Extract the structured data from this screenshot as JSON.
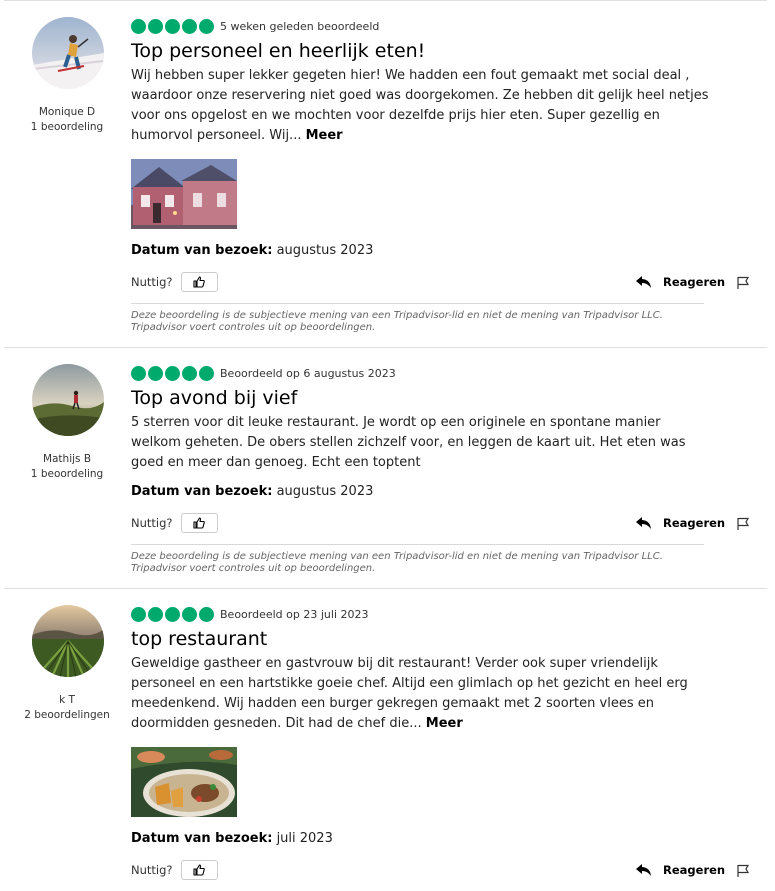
{
  "reviews": [
    {
      "author": "Monique D",
      "contributions": "1 beoordeling",
      "rating": 5,
      "date_text": "5 weken geleden beoordeeld",
      "title": "Top personeel en heerlijk eten!",
      "body": "Wij hebben super lekker gegeten hier! We hadden een fout gemaakt met social deal , waardoor onze reservering niet goed was doorgekomen. Ze hebben dit gelijk heel netjes voor ons opgelost en we mochten voor dezelfde prijs hier eten. Super gezellig en humorvol personeel. Wij...",
      "more_label": "Meer",
      "visit_label": "Datum van bezoek:",
      "visit_value": "augustus 2023",
      "helpful_label": "Nuttig?",
      "reply_label": "Reageren",
      "disclaimer": "Deze beoordeling is de subjectieve mening van een Tripadvisor-lid en niet de mening van Tripadvisor LLC. Tripadvisor voert controles uit op beoordelingen."
    },
    {
      "author": "Mathijs B",
      "contributions": "1 beoordeling",
      "rating": 5,
      "date_text": "Beoordeeld op 6 augustus 2023",
      "title": "Top avond bij vief",
      "body": "5 sterren voor dit leuke restaurant. Je wordt op een originele en spontane manier welkom geheten. De obers stellen zichzelf voor, en leggen de kaart uit. Het eten was goed en meer dan genoeg. Echt een toptent",
      "visit_label": "Datum van bezoek:",
      "visit_value": "augustus 2023",
      "helpful_label": "Nuttig?",
      "reply_label": "Reageren",
      "disclaimer": "Deze beoordeling is de subjectieve mening van een Tripadvisor-lid en niet de mening van Tripadvisor LLC. Tripadvisor voert controles uit op beoordelingen."
    },
    {
      "author": "k T",
      "contributions": "2 beoordelingen",
      "rating": 5,
      "date_text": "Beoordeeld op 23 juli 2023",
      "title": "top restaurant",
      "body": "Geweldige gastheer en gastvrouw bij dit restaurant! Verder ook super vriendelijk personeel en een hartstikke goeie chef. Altijd een glimlach op het gezicht en heel erg meedenkend. Wij hadden een burger gekregen gemaakt met 2 soorten vlees en doormidden gesneden. Dit had de chef die...",
      "more_label": "Meer",
      "visit_label": "Datum van bezoek:",
      "visit_value": "juli 2023",
      "helpful_label": "Nuttig?",
      "reply_label": "Reageren"
    }
  ],
  "colors": {
    "bubble": "#00aa6c"
  },
  "icons": {
    "thumb": "thumbs-up-icon",
    "reply": "reply-arrow-icon",
    "flag": "flag-icon"
  }
}
